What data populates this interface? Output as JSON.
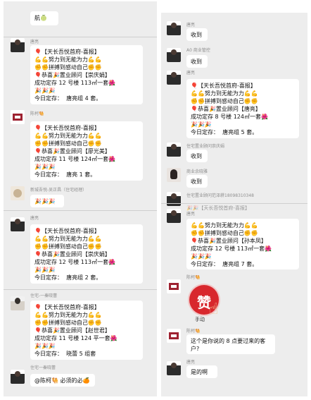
{
  "left_column": {
    "top_line": "航🍈",
    "posts": [
      {
        "sender": "唐亮",
        "text": "🎈【天长吾悦首府-喜报】\n💪💪努力到无能为力💪💪\n✊✊拼搏到感动自己✊✊\n🎈恭喜🎉置业顾问【崇庆娟】\n成功定存 12 号楼 113㎡一套🌺\n🎉🎉🎉\n今日定存：  唐亮组 4 套。"
      },
      {
        "sender": "陈柯🐫",
        "text": "🎈【天长吾悦首府-喜报】\n💪💪努力到无能为力💪💪\n✊✊拼搏到感动自己✊✊\n🎈恭喜🎉置业顾问【廖光美】\n成功定存 11 号楼 124㎡一套🌺\n🎉🎉🎉\n今日定存：  唐亮 1 套。"
      },
      {
        "sender": "新城吾悦-吴正昌（住宅经理）",
        "text": "🎉🎉🎉"
      },
      {
        "sender": "唐亮",
        "text": "🎈【天长吾悦首府-喜报】\n💪💪努力到无能为力💪💪\n✊✊拼搏到感动自己✊✊\n🎈恭喜🎉置业顾问【崇庆娟】\n成功定存 12 号楼 113㎡一套🌺\n🎉🎉🎉\n今日定存：  唐亮组 2 套。"
      }
    ],
    "bottom_posts": [
      {
        "sender": "住宅-一秦晓蕾",
        "text": "🎈【天长吾悦首府-喜报】\n💪💪努力到无能为力💪💪\n✊✊拼搏到感动自己✊✊\n🎈恭喜🎉置业顾问【赵世君】\n成功定存 11 号楼 124 平一套🌺\n🎉🎉🎉\n今日定存：  晓蕾 5 组套"
      },
      {
        "sender": "住宅一秦晓蕾",
        "text": "@陈柯🐫 必须的必🍊"
      }
    ]
  },
  "right_column": {
    "top_posts": [
      {
        "sender": "唐亮",
        "text": "收到"
      },
      {
        "sender": "A0 商业管控",
        "text": "收到"
      },
      {
        "sender": "唐亮",
        "text": "🎈【天长吾悦首府-喜报】\n💪💪努力到无能为力💪💪\n✊✊拼搏到感动自己✊✊\n🎈恭喜🎉置业顾问【唐亮】\n成功定存 8 号楼 124㎡一套🌺\n🎉🎉🎉\n今日定存：  唐亮组 5 套。"
      },
      {
        "sender": "住宅置业顾问崇庆娟",
        "text": "收到"
      },
      {
        "sender": "商业余晓雅",
        "text": "收到"
      },
      {
        "sender": "住宅置业顾问范泽耕18098310348",
        "text": ""
      }
    ],
    "bottom_header_partial": "🎉🎉【天长吾悦首府-喜报】",
    "bottom_posts": [
      {
        "sender": "唐亮",
        "text": "💪💪努力到无能为力💪💪\n✊✊拼搏到感动自己✊✊\n🎈恭喜🎉置业顾问【孙本凤】\n成功定存 12 号楼 113㎡一套🌺\n🎉🎉🎉\n今日定存：  唐亮组 7 套。"
      },
      {
        "sender": "陈柯🐫",
        "sticker_caption": "手动"
      },
      {
        "sender": "陈柯🐫",
        "text": "这个是你说的 8 点要过来的客\n户?"
      },
      {
        "sender": "唐亮",
        "text": "是的啊 。"
      }
    ]
  }
}
